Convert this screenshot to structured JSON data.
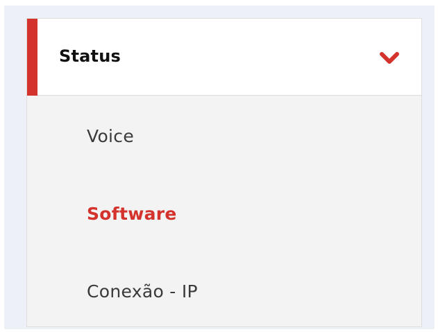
{
  "menu": {
    "header": {
      "title": "Status",
      "expanded": true,
      "toggle_icon": "chevron-down-icon"
    },
    "items": [
      {
        "label": "Voice",
        "active": false
      },
      {
        "label": "Software",
        "active": true
      },
      {
        "label": "Conexão - IP",
        "active": false
      }
    ]
  },
  "colors": {
    "accent": "#d4322c",
    "header_background": "#ffffff",
    "submenu_background": "#f3f3f3",
    "page_background": "#eef0f7",
    "text": "#3a3a3a"
  }
}
